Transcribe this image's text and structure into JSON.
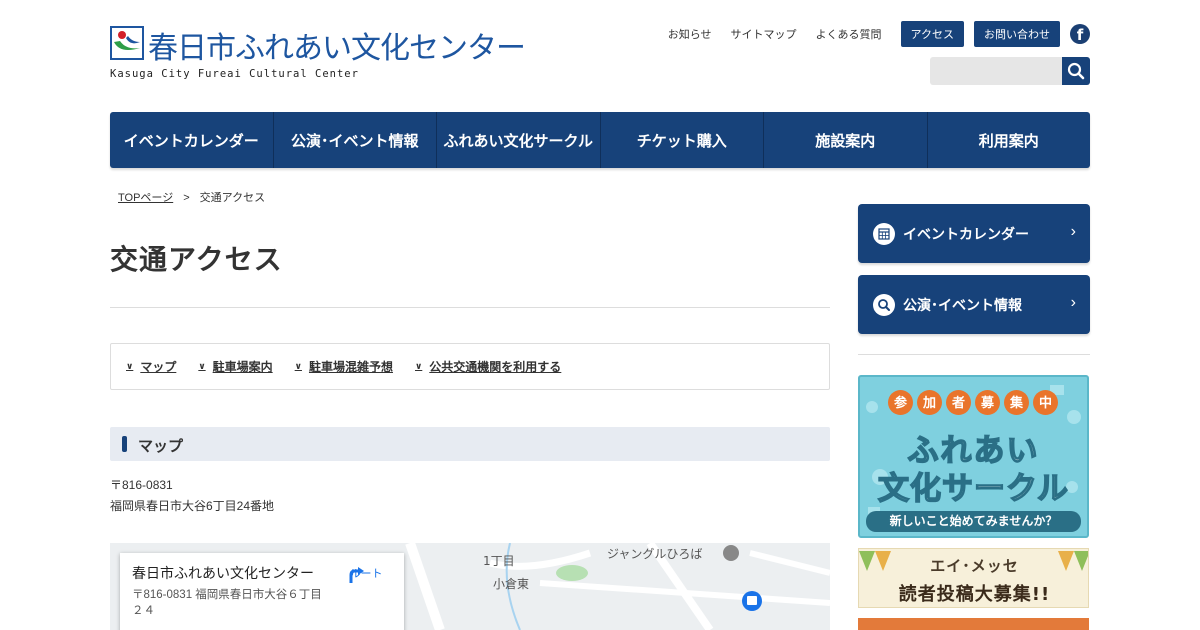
{
  "site": {
    "logo_title": "春日市ふれあい文化センター",
    "logo_subtitle": "Kasuga City Fureai Cultural Center"
  },
  "header": {
    "links": [
      "お知らせ",
      "サイトマップ",
      "よくある質問"
    ],
    "access_label": "アクセス",
    "contact_label": "お問い合わせ",
    "facebook_glyph": "f",
    "search_placeholder": ""
  },
  "nav": {
    "items": [
      "イベントカレンダー",
      "公演･イベント情報",
      "ふれあい文化サークル",
      "チケット購入",
      "施設案内",
      "利用案内"
    ]
  },
  "breadcrumb": {
    "home": "TOPページ",
    "separator": ">",
    "current": "交通アクセス"
  },
  "page": {
    "title": "交通アクセス",
    "anchors": [
      "マップ",
      "駐車場案内",
      "駐車場混雑予想",
      "公共交通機関を利用する"
    ],
    "section_title": "マップ",
    "postal": "〒816-0831",
    "address": "福岡県春日市大谷6丁目24番地"
  },
  "map": {
    "card_name": "春日市ふれあい文化センター",
    "card_address": "〒816-0831 福岡県春日市大谷６丁目２４",
    "route_label": "ルート",
    "labels": [
      "1丁目",
      "小倉東",
      "ジャングルひろば"
    ]
  },
  "sidebar": {
    "buttons": [
      "イベントカレンダー",
      "公演･イベント情報"
    ],
    "banner1": {
      "badge_chars": [
        "参",
        "加",
        "者",
        "募",
        "集",
        "中"
      ],
      "line1": "ふれあい",
      "line2": "文化サークル",
      "footer": "新しいこと始めてみませんか？"
    },
    "banner2": {
      "line1": "エイ･メッセ",
      "line2": "読者投稿大募集!!"
    }
  },
  "colors": {
    "brand_navy": "#17427a",
    "logo_blue": "#1e56a0",
    "section_bg": "#e7ebf2",
    "banner_teal": "#7fd0df",
    "badge_orange": "#e9742b"
  }
}
